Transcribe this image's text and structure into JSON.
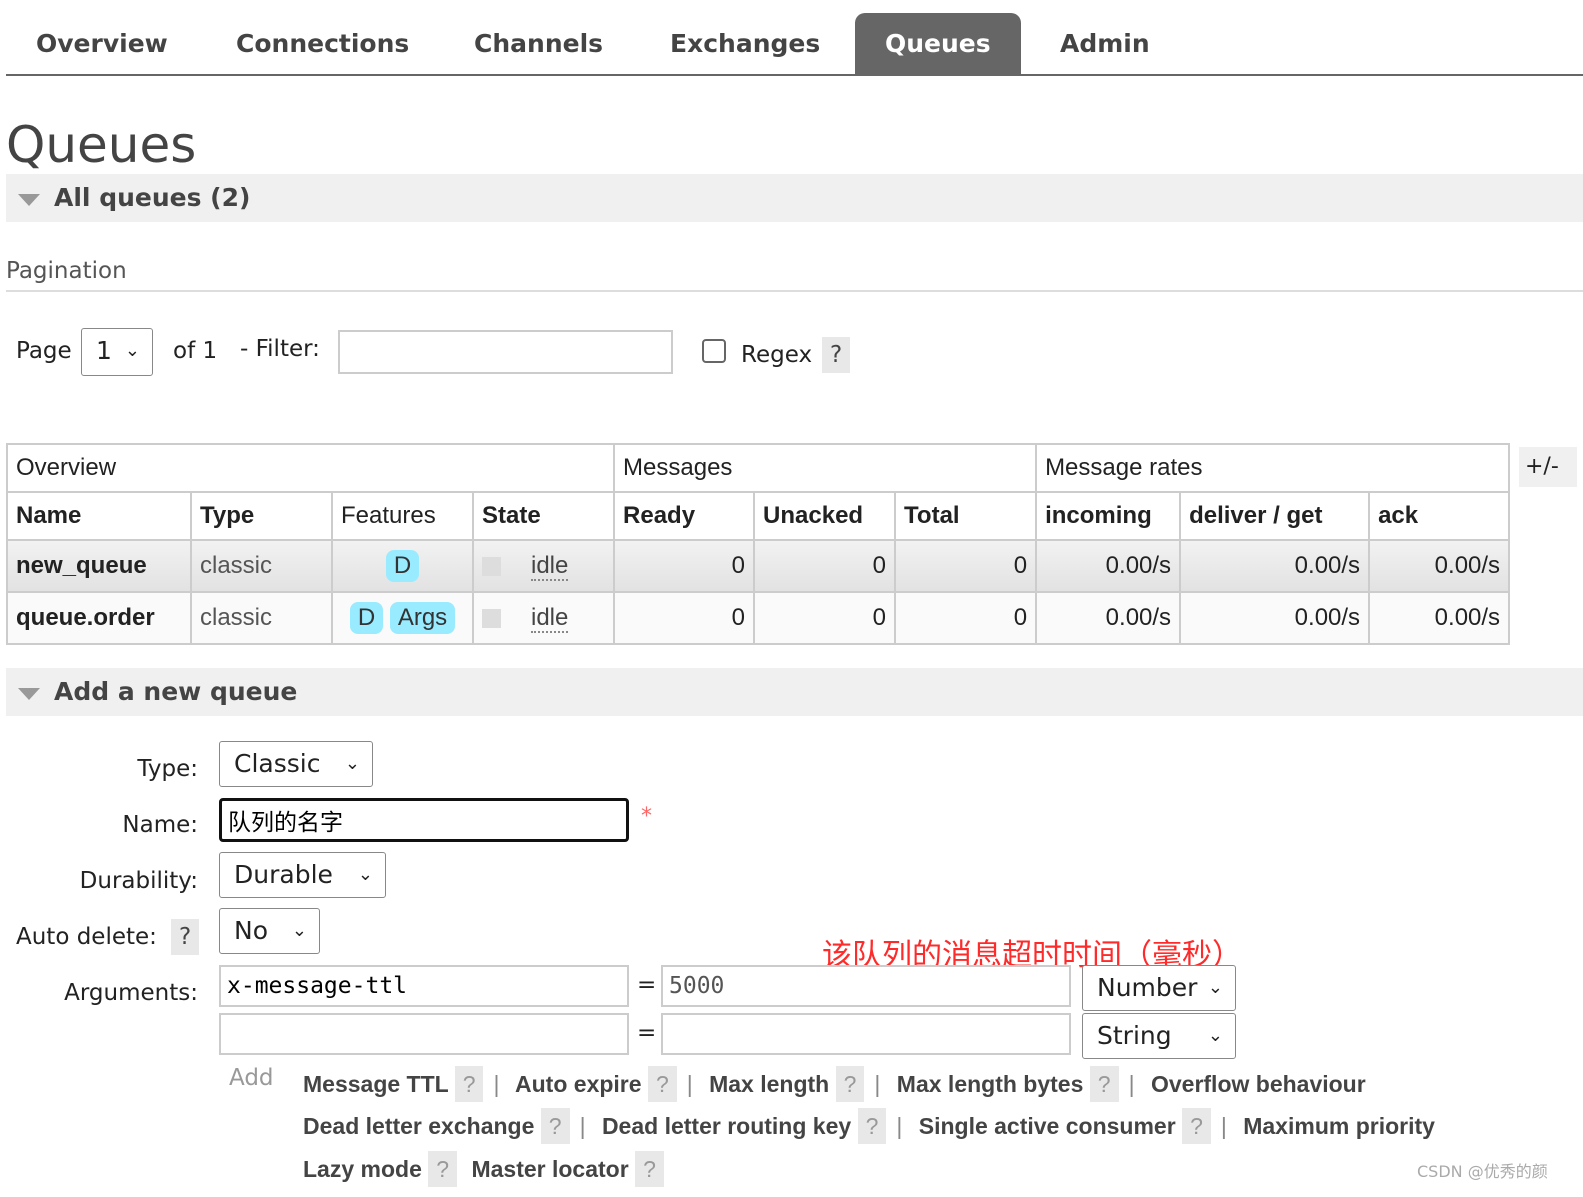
{
  "tabs": [
    {
      "label": "Overview"
    },
    {
      "label": "Connections"
    },
    {
      "label": "Channels"
    },
    {
      "label": "Exchanges"
    },
    {
      "label": "Queues",
      "active": true
    },
    {
      "label": "Admin"
    }
  ],
  "page_title": "Queues",
  "all_queues": {
    "title": "All queues (2)"
  },
  "pagination": {
    "title": "Pagination",
    "page_label": "Page",
    "page_value": "1",
    "of_label": "of 1",
    "filter_label": "- Filter:",
    "filter_value": "",
    "regex_label": "Regex",
    "help": "?"
  },
  "table": {
    "groups": [
      "Overview",
      "Messages",
      "Message rates"
    ],
    "plus_minus": "+/-",
    "columns": [
      "Name",
      "Type",
      "Features",
      "State",
      "Ready",
      "Unacked",
      "Total",
      "incoming",
      "deliver / get",
      "ack"
    ],
    "rows": [
      {
        "name": "new_queue",
        "type": "classic",
        "features": [
          "D"
        ],
        "state": "idle",
        "ready": "0",
        "unacked": "0",
        "total": "0",
        "incoming": "0.00/s",
        "deliver_get": "0.00/s",
        "ack": "0.00/s"
      },
      {
        "name": "queue.order",
        "type": "classic",
        "features": [
          "D",
          "Args"
        ],
        "state": "idle",
        "ready": "0",
        "unacked": "0",
        "total": "0",
        "incoming": "0.00/s",
        "deliver_get": "0.00/s",
        "ack": "0.00/s"
      }
    ]
  },
  "add_queue": {
    "title": "Add a new queue",
    "type_label": "Type:",
    "type_value": "Classic",
    "name_label": "Name:",
    "name_value": "队列的名字",
    "required": "*",
    "durability_label": "Durability:",
    "durability_value": "Durable",
    "auto_delete_label": "Auto delete:",
    "auto_delete_value": "No",
    "arguments_label": "Arguments:",
    "args": [
      {
        "key": "x-message-ttl",
        "value": "5000",
        "type": "Number"
      },
      {
        "key": "",
        "value": "",
        "type": "String"
      }
    ],
    "eq": "=",
    "add_label": "Add",
    "hints": [
      "Message TTL",
      "Auto expire",
      "Max length",
      "Max length bytes",
      "Overflow behaviour",
      "Dead letter exchange",
      "Dead letter routing key",
      "Single active consumer",
      "Maximum priority",
      "Lazy mode",
      "Master locator"
    ]
  },
  "annotation": "该队列的消息超时时间（毫秒）",
  "watermark": "CSDN @优秀的颜",
  "colors": {
    "active_tab": "#666666",
    "badge": "#99ebff",
    "annotation": "#ff2a2a"
  }
}
